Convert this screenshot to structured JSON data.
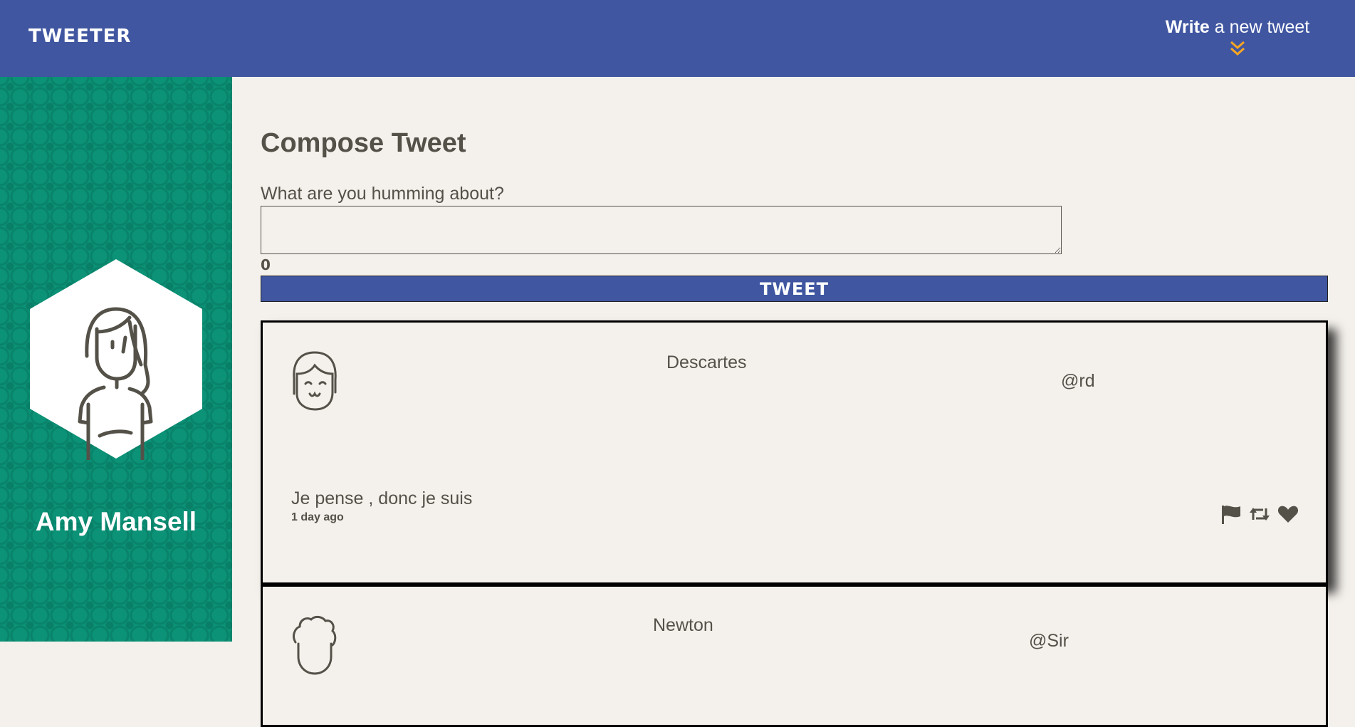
{
  "header": {
    "logo": "TWEETER",
    "write_bold": "Write",
    "write_rest": " a new tweet"
  },
  "sidebar": {
    "user_name": "Amy Mansell"
  },
  "compose": {
    "title": "Compose Tweet",
    "label": "What are you humming about?",
    "input_value": "",
    "counter": "0",
    "button_label": "TWEET"
  },
  "tweets": [
    {
      "name": "Descartes",
      "handle": "@rd",
      "body": "Je pense , donc je suis",
      "time": "1 day ago",
      "actions": [
        "flag-icon",
        "retweet-icon",
        "heart-icon"
      ]
    },
    {
      "name": "Newton",
      "handle": "@Sir",
      "body": "",
      "time": ""
    }
  ],
  "colors": {
    "header_bg": "#4056a1",
    "sidebar_bg": "#0b9277",
    "page_bg": "#f4f1ec",
    "text": "#545149",
    "chevron": "#f6a623"
  }
}
